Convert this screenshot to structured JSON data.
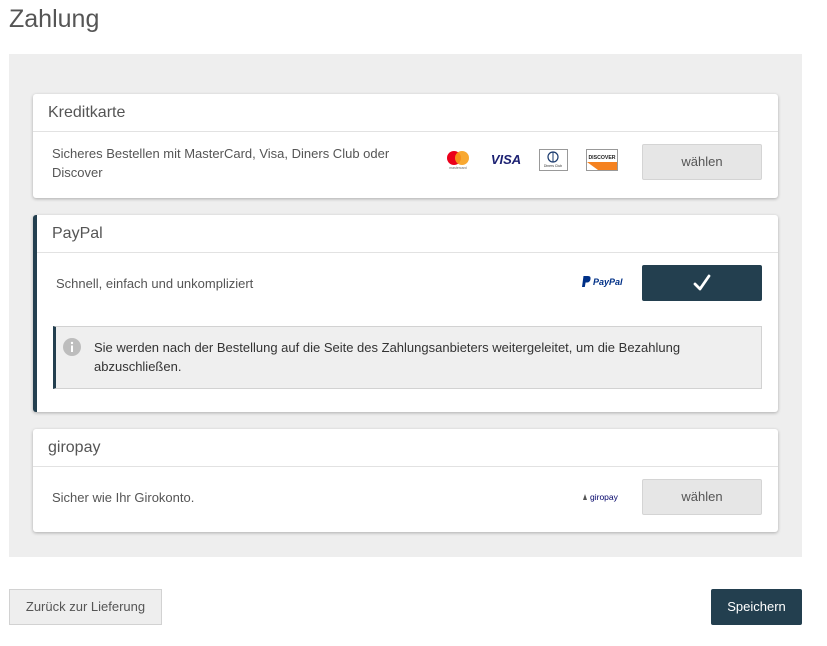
{
  "page": {
    "title": "Zahlung"
  },
  "methods": [
    {
      "name": "Kreditkarte",
      "description": "Sicheres Bestellen mit MasterCard, Visa, Diners Club oder Discover",
      "button_label": "wählen",
      "selected": false,
      "logos": {
        "mastercard_caption": "mastercard",
        "visa": "VISA",
        "diners": "Diners Club",
        "discover": "DISCOVER"
      }
    },
    {
      "name": "PayPal",
      "description": "Schnell, einfach und unkompliziert",
      "button_label": "✓",
      "selected": true,
      "logo_text": "PayPal",
      "info": "Sie werden nach der Bestellung auf die Seite des Zahlungsanbieters weitergeleitet, um die Bezahlung abzuschließen."
    },
    {
      "name": "giropay",
      "description": "Sicher wie Ihr Girokonto.",
      "button_label": "wählen",
      "selected": false,
      "logo_text": "giropay"
    }
  ],
  "footer": {
    "back_label": "Zurück zur Lieferung",
    "save_label": "Speichern"
  },
  "colors": {
    "accent": "#233f4f",
    "panel_bg": "#eeeeee",
    "button_bg": "#e6e6e6"
  }
}
